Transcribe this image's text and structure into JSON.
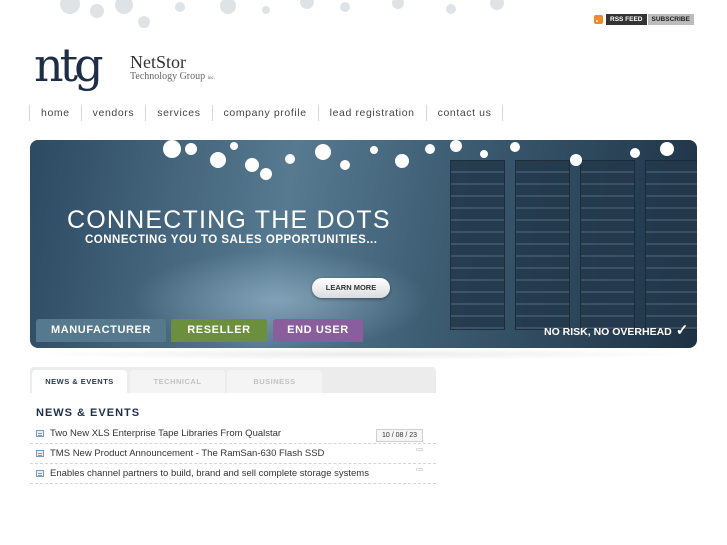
{
  "header": {
    "rss": {
      "feed_label": "RSS FEED",
      "subscribe_label": "SUBSCRIBE"
    },
    "logo": {
      "mark": "ntg",
      "name": "NetStor",
      "tagline": "Technology Group",
      "suffix": "inc."
    }
  },
  "nav": [
    {
      "label": "home"
    },
    {
      "label": "vendors"
    },
    {
      "label": "services"
    },
    {
      "label": "company profile"
    },
    {
      "label": "lead registration"
    },
    {
      "label": "contact us"
    }
  ],
  "banner": {
    "headline": "CONNECTING THE DOTS",
    "subheadline": "CONNECTING YOU TO SALES OPPORTUNITIES...",
    "learn_more": "LEARN MORE",
    "tabs": [
      "MANUFACTURER",
      "RESELLER",
      "END USER"
    ],
    "tagline": "NO RISK, NO OVERHEAD",
    "colors": {
      "manufacturer": "#56798d",
      "reseller": "#6b8f3c",
      "end_user": "#8a5d9c"
    }
  },
  "content_tabs": [
    "NEWS & EVENTS",
    "TECHNICAL",
    "BUSINESS"
  ],
  "news": {
    "title": "NEWS & EVENTS",
    "date": "10 / 08 / 23",
    "items": [
      "Two New XLS Enterprise Tape Libraries From Qualstar",
      "TMS New Product Announcement - The RamSan-630 Flash SSD",
      "Enables channel partners to build, brand and sell complete storage systems"
    ]
  }
}
